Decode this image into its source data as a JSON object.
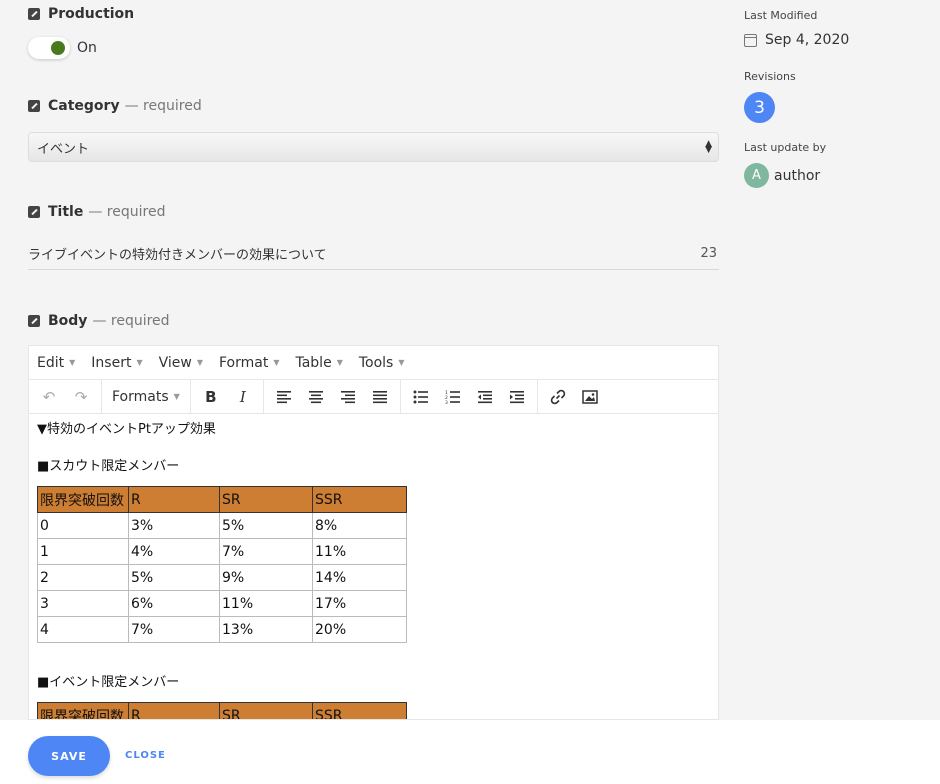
{
  "fields": {
    "production": {
      "label": "Production",
      "toggle_text": "On",
      "checked": true
    },
    "category": {
      "label": "Category",
      "required": "— required",
      "value": "イベント"
    },
    "title": {
      "label": "Title",
      "required": "— required",
      "value": "ライブイベントの特効付きメンバーの効果について",
      "count": "23"
    },
    "body": {
      "label": "Body",
      "required": "— required"
    }
  },
  "editor": {
    "menu": [
      "Edit",
      "Insert",
      "View",
      "Format",
      "Table",
      "Tools"
    ],
    "formats_label": "Formats",
    "content": {
      "heading": "▼特効のイベントPtアップ効果",
      "section1": "■スカウト限定メンバー",
      "table1": {
        "header": [
          "限界突破回数",
          "R",
          "SR",
          "SSR"
        ],
        "rows": [
          [
            "0",
            "3%",
            "5%",
            "8%"
          ],
          [
            "1",
            "4%",
            "7%",
            "11%"
          ],
          [
            "2",
            "5%",
            "9%",
            "14%"
          ],
          [
            "3",
            "6%",
            "11%",
            "17%"
          ],
          [
            "4",
            "7%",
            "13%",
            "20%"
          ]
        ]
      },
      "section2": "■イベント限定メンバー",
      "table2": {
        "header": [
          "限界突破回数",
          "R",
          "SR",
          "SSR"
        ]
      }
    }
  },
  "sidebar": {
    "last_modified_label": "Last Modified",
    "last_modified_value": "Sep 4, 2020",
    "revisions_label": "Revisions",
    "revisions_count": "3",
    "last_update_label": "Last update by",
    "author_initial": "A",
    "author_name": "author"
  },
  "actions": {
    "save": "SAVE",
    "close": "CLOSE"
  },
  "colors": {
    "accent": "#4e86f5",
    "table_header": "#cd7e32",
    "toggle_on": "#4a7a1e",
    "avatar": "#7fb79f"
  }
}
